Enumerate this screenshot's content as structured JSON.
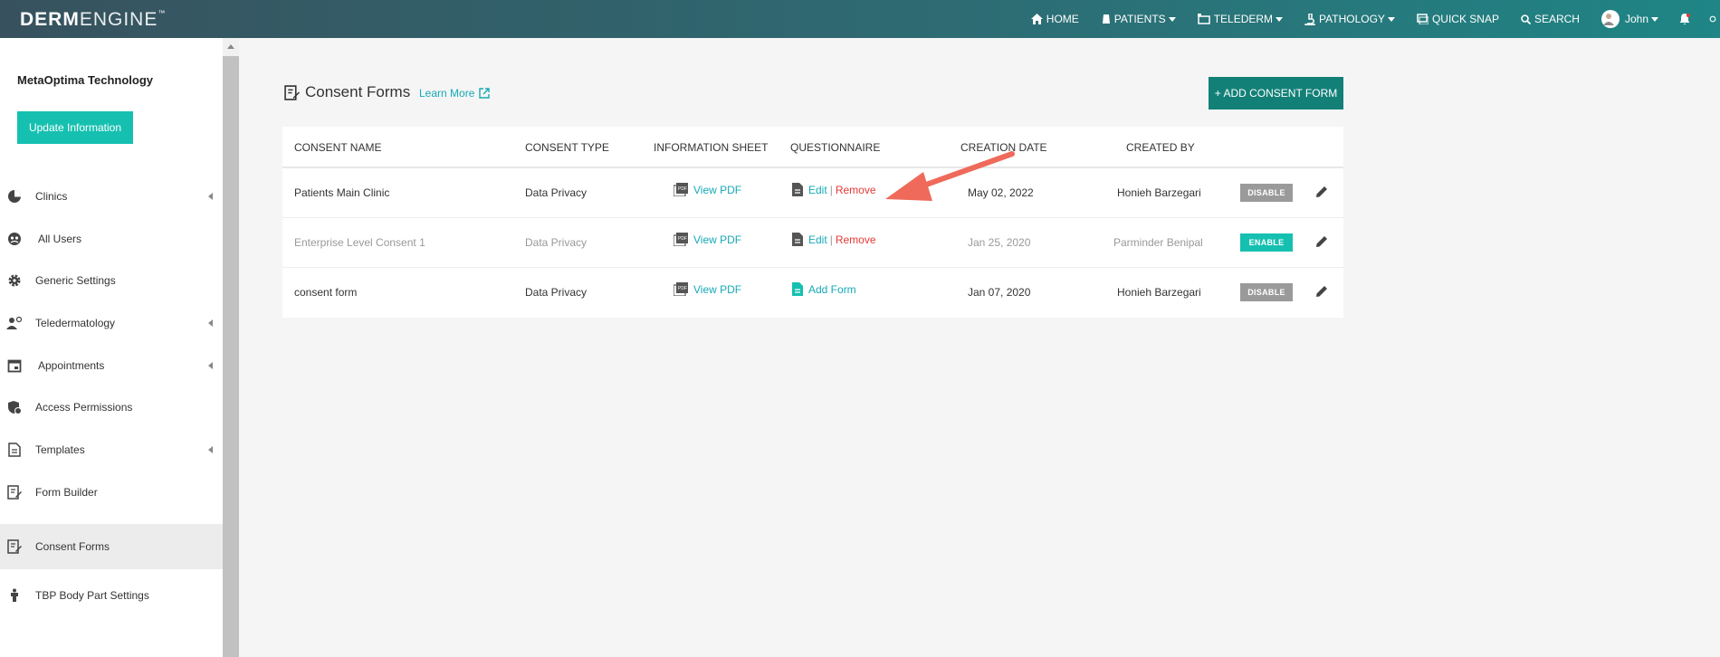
{
  "app": {
    "logo_bold": "DERM",
    "logo_thin": "ENGINE",
    "logo_tm": "™"
  },
  "nav": {
    "home": "HOME",
    "patients": "PATIENTS",
    "telederm": "TELEDERM",
    "pathology": "PATHOLOGY",
    "quick_snap": "QUICK SNAP",
    "search": "SEARCH",
    "user": "John"
  },
  "sidebar": {
    "org_name": "MetaOptima Technology",
    "update_label": "Update Information",
    "items": [
      {
        "label": "Clinics",
        "icon": "pie-chart-icon"
      },
      {
        "label": "All Users",
        "icon": "users-icon"
      },
      {
        "label": "Generic Settings",
        "icon": "gear-icon"
      },
      {
        "label": "Teledermatology",
        "icon": "doctor-icon"
      },
      {
        "label": "Appointments",
        "icon": "calendar-icon"
      },
      {
        "label": "Access Permissions",
        "icon": "shield-icon"
      },
      {
        "label": "Templates",
        "icon": "document-icon"
      },
      {
        "label": "Form Builder",
        "icon": "form-icon"
      },
      {
        "label": "Consent Forms",
        "icon": "edit-form-icon"
      },
      {
        "label": "TBP Body Part Settings",
        "icon": "body-icon"
      }
    ]
  },
  "main": {
    "title": "Consent Forms",
    "learn_more": "Learn More",
    "add_label": "+ ADD CONSENT FORM",
    "columns": [
      "CONSENT NAME",
      "CONSENT TYPE",
      "INFORMATION SHEET",
      "QUESTIONNAIRE",
      "CREATION DATE",
      "CREATED BY"
    ],
    "rows": [
      {
        "name": "Patients Main Clinic",
        "type": "Data Privacy",
        "sheet": "View PDF",
        "q_edit": "Edit",
        "q_sep": "|",
        "q_remove": "Remove",
        "date": "May 02, 2022",
        "created_by": "Honieh Barzegari",
        "status": "DISABLE"
      },
      {
        "name": "Enterprise Level Consent 1",
        "type": "Data Privacy",
        "sheet": "View PDF",
        "q_edit": "Edit",
        "q_sep": "|",
        "q_remove": "Remove",
        "date": "Jan 25, 2020",
        "created_by": "Parminder Benipal",
        "status": "ENABLE"
      },
      {
        "name": "consent form",
        "type": "Data Privacy",
        "sheet": "View PDF",
        "q_add": "Add Form",
        "date": "Jan 07, 2020",
        "created_by": "Honieh Barzegari",
        "status": "DISABLE"
      }
    ]
  },
  "colors": {
    "accent": "#16c0b0",
    "add_button": "#138078",
    "remove": "#e53935",
    "link": "#16a9b6",
    "arrow": "#ef6a5a"
  }
}
